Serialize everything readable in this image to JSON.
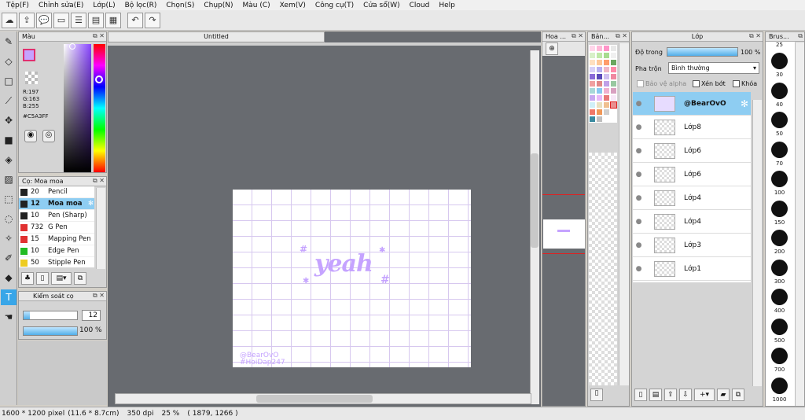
{
  "menu": [
    "Tệp(F)",
    "Chỉnh sửa(E)",
    "Lớp(L)",
    "Bộ lọc(R)",
    "Chọn(S)",
    "Chụp(N)",
    "Màu (C)",
    "Xem(V)",
    "Công cụ(T)",
    "Cửa sổ(W)",
    "Cloud",
    "Help"
  ],
  "color_panel": {
    "title": "Màu",
    "primary_color": "#C5A3FF",
    "r": "R:197",
    "g": "G:163",
    "b": "B:255",
    "hex": "#C5A3FF"
  },
  "brush_panel": {
    "title": "Cọ: Moa moa",
    "items": [
      {
        "size": "20",
        "name": "Pencil",
        "color": "#222222"
      },
      {
        "size": "12",
        "name": "Moa moa",
        "color": "#222222"
      },
      {
        "size": "10",
        "name": "Pen (Sharp)",
        "color": "#222222"
      },
      {
        "size": "732",
        "name": "G Pen",
        "color": "#e03030"
      },
      {
        "size": "15",
        "name": "Mapping Pen",
        "color": "#e03030"
      },
      {
        "size": "10",
        "name": "Edge Pen",
        "color": "#22bb22"
      },
      {
        "size": "50",
        "name": "Stipple Pen",
        "color": "#eecc22"
      }
    ]
  },
  "brush_control": {
    "title": "Kiểm soát cọ",
    "size_value": "12",
    "opacity_value": "100 %",
    "size_fraction": 0.12,
    "opacity_fraction": 1.0
  },
  "document": {
    "tab_title": "Untitled",
    "art_text": "yeah",
    "watermark_1": "@BearOvO",
    "watermark_2": "#HoiDap247"
  },
  "navigator": {
    "title": "Hoa ..."
  },
  "swatches": {
    "title": "Bản...",
    "colors": [
      "#ffd6ea",
      "#ffb8d8",
      "#ff94c8",
      "#e8e8e8",
      "#d8f0c8",
      "#c0e8a8",
      "#a8dc90",
      "#f0f0f0",
      "#ffe0c0",
      "#ffc898",
      "#ff9d6a",
      "#6aa860",
      "#d8d0f8",
      "#b8b0f0",
      "#f0b8c8",
      "#ff8aa8",
      "#8a6ad8",
      "#5a4ab8",
      "#d0c0f0",
      "#f088a0",
      "#f0a0a0",
      "#e08888",
      "#c0a0e8",
      "#98c8a0",
      "#a8d8d8",
      "#88c8f0",
      "#f0b0d0",
      "#d8a0c0",
      "#c8a8f0",
      "#e8b8f8",
      "#e87878",
      "#f8e8f8",
      "#d0f0f8",
      "#e8e0c0",
      "#f0c090",
      "#e89090",
      "#f07868",
      "#f09858",
      "#d0d0d0",
      "#ffffff",
      "#3a8aa0",
      "#c0c0c0",
      "#ffffff",
      "#ffffff"
    ]
  },
  "layer_panel": {
    "title": "Lớp",
    "opacity_label": "Độ trong",
    "opacity_value": "100 %",
    "opacity_fraction": 1.0,
    "blend_label": "Pha trộn",
    "blend_value": "Bình thường",
    "protect_alpha": "Bảo vệ alpha",
    "clipping": "Xén bớt",
    "lock": "Khóa",
    "layers": [
      "@BearOvO",
      "Lớp8",
      "Lớp6",
      "Lớp6",
      "Lớp4",
      "Lớp4",
      "Lớp3",
      "Lớp1"
    ]
  },
  "brush_size_panel": {
    "title": "Brus...",
    "sizes": [
      "25",
      "30",
      "40",
      "50",
      "70",
      "100",
      "150",
      "200",
      "300",
      "400",
      "500",
      "700",
      "1000"
    ]
  },
  "status": {
    "dimensions": "1600 * 1200 pixel",
    "physical": "(11.6 * 8.7cm)",
    "dpi": "350 dpi",
    "zoom": "25 %",
    "coords": "( 1879, 1266 )"
  }
}
